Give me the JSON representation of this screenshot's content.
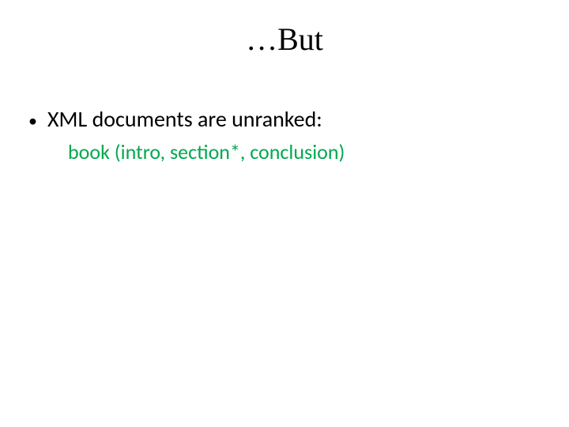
{
  "title": "…But",
  "bullet1": "XML documents are unranked:",
  "sub1": "book (intro, section*, conclusion)",
  "bullet_glyph": "•"
}
